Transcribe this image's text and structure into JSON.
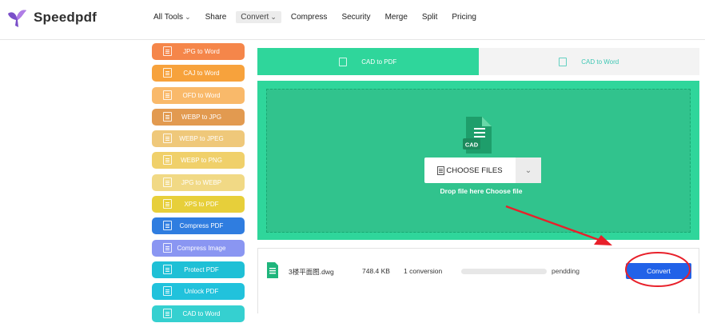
{
  "header": {
    "brand": "Speedpdf",
    "nav": [
      {
        "label": "All Tools",
        "has_chevron": true
      },
      {
        "label": "Share",
        "has_chevron": false
      },
      {
        "label": "Convert",
        "has_chevron": true,
        "active": true
      },
      {
        "label": "Compress",
        "has_chevron": false
      },
      {
        "label": "Security",
        "has_chevron": false
      },
      {
        "label": "Merge",
        "has_chevron": false
      },
      {
        "label": "Split",
        "has_chevron": false
      },
      {
        "label": "Pricing",
        "has_chevron": false
      }
    ]
  },
  "sidebar": {
    "items": [
      {
        "label": "JPG to Word",
        "color": "#f5864a"
      },
      {
        "label": "CAJ to Word",
        "color": "#f7a23c"
      },
      {
        "label": "OFD to Word",
        "color": "#f9b96a"
      },
      {
        "label": "WEBP to JPG",
        "color": "#e29a50"
      },
      {
        "label": "WEBP to JPEG",
        "color": "#efc87a"
      },
      {
        "label": "WEBP to PNG",
        "color": "#f0d06a"
      },
      {
        "label": "JPG to WEBP",
        "color": "#f1d985"
      },
      {
        "label": "XPS to PDF",
        "color": "#e7cf3a"
      },
      {
        "label": "Compress PDF",
        "color": "#2f7de0"
      },
      {
        "label": "Compress Image",
        "color": "#8a96f2"
      },
      {
        "label": "Protect PDF",
        "color": "#1fc0d6"
      },
      {
        "label": "Unlock PDF",
        "color": "#21c2dc"
      },
      {
        "label": "CAD to Word",
        "color": "#35d0d0"
      }
    ]
  },
  "tabs": [
    {
      "label": "CAD to PDF",
      "active": true
    },
    {
      "label": "CAD to Word",
      "active": false
    }
  ],
  "upload": {
    "illustration_label": "CAD",
    "choose_label": "CHOOSE FILES",
    "drop_text": "Drop file here Choose file"
  },
  "file_row": {
    "name": "3楼平面图.dwg",
    "size": "748.4 KB",
    "conversions": "1 conversion",
    "progress": 0,
    "status": "pendding",
    "convert_label": "Convert"
  },
  "colors": {
    "accent_green": "#2fd69b",
    "convert_blue": "#2162e8",
    "annotation_red": "#e8202a"
  }
}
